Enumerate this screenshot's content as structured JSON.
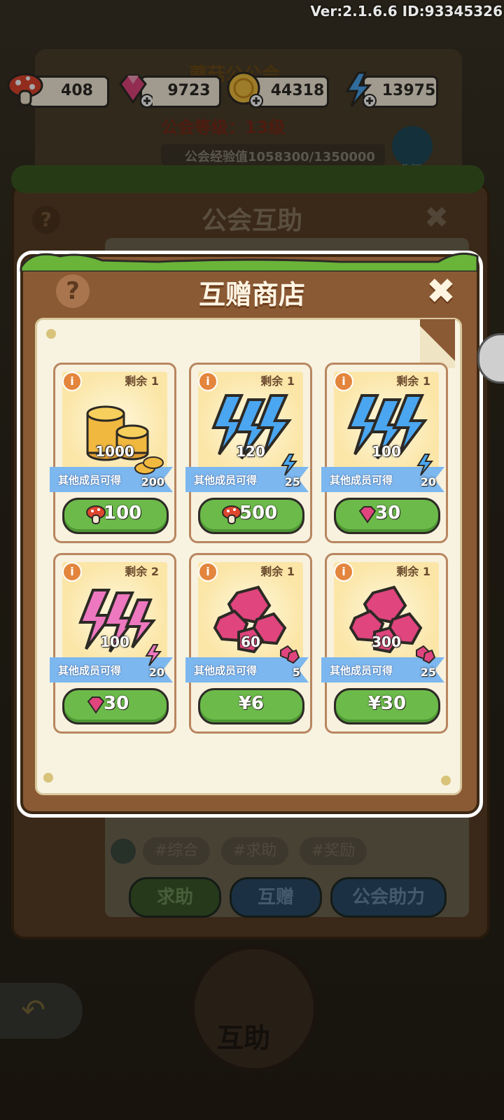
{
  "version_text": "Ver:2.1.6.6 ID:93345326",
  "currencies": {
    "mushroom": "408",
    "gem": "9723",
    "coin": "44318",
    "energy": "13975"
  },
  "guild_panel": {
    "name": "蘑菇公公会",
    "level_text": "公会等级：13级",
    "exp_text": "公会经验值1058300/1350000",
    "upgrade_label": "升级"
  },
  "back_dialog": {
    "title": "公会互助",
    "tags": [
      "#综合",
      "#求助",
      "#奖励"
    ],
    "buttons": [
      "求助",
      "互赠",
      "公会助力"
    ],
    "bottom_label": "互助"
  },
  "shop": {
    "title": "互赠商店",
    "help_label": "?",
    "close_label": "✖",
    "ribbon_label": "其他成员可得",
    "items": [
      {
        "remain": "剩余 1",
        "icon": "coin-stack",
        "amount": "1000",
        "bonus": "200",
        "bonus_icon": "coin",
        "price": "100",
        "price_icon": "mushroom"
      },
      {
        "remain": "剩余 1",
        "icon": "energy-bolt",
        "amount": "120",
        "bonus": "25",
        "bonus_icon": "energy",
        "price": "500",
        "price_icon": "mushroom"
      },
      {
        "remain": "剩余 1",
        "icon": "energy-bolt",
        "amount": "100",
        "bonus": "20",
        "bonus_icon": "energy",
        "price": "30",
        "price_icon": "gem"
      },
      {
        "remain": "剩余 2",
        "icon": "pink-bolt",
        "amount": "100",
        "bonus": "20",
        "bonus_icon": "pink-energy",
        "price": "30",
        "price_icon": "gem"
      },
      {
        "remain": "剩余 1",
        "icon": "gem-pile",
        "amount": "60",
        "bonus": "5",
        "bonus_icon": "gem",
        "price": "¥6",
        "price_icon": ""
      },
      {
        "remain": "剩余 1",
        "icon": "gem-pile",
        "amount": "300",
        "bonus": "25",
        "bonus_icon": "gem",
        "price": "¥30",
        "price_icon": ""
      }
    ]
  },
  "colors": {
    "dialog_brown": "#8a5a35",
    "price_green": "#6cbb4a",
    "ribbon_blue": "#7cb7ef",
    "gem_pink": "#e0457d"
  }
}
